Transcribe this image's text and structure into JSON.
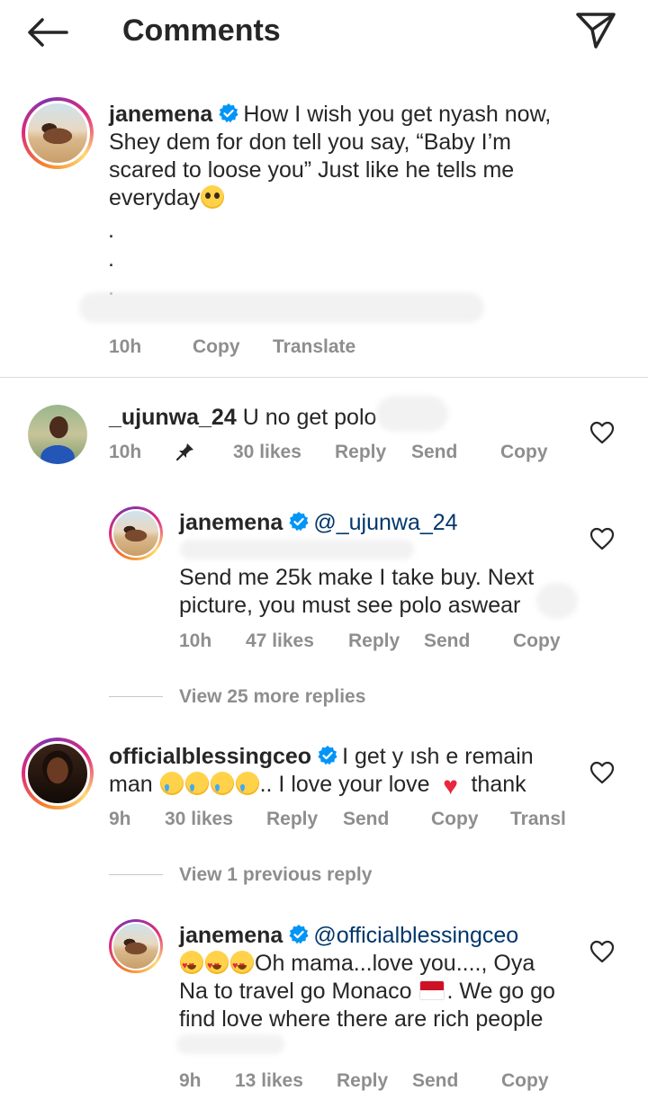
{
  "header": {
    "title": "Comments"
  },
  "caption": {
    "username": "janemena",
    "text_line1": "How I wish you get nyash now,",
    "text_line2": "Shey dem for don tell you say, “Baby I’m",
    "text_line3": "scared to loose you” Just like he tells me",
    "text_line4": "everyday",
    "dot": ".",
    "time": "10h",
    "copy": "Copy",
    "translate": "Translate"
  },
  "comments": [
    {
      "username": "_ujunwa_24",
      "text": "U no get polo",
      "time": "10h",
      "likes": "30 likes",
      "reply": "Reply",
      "send": "Send",
      "copy": "Copy"
    },
    {
      "username": "janemena",
      "mention": "@_ujunwa_24",
      "text_line1": "Send me 25k make I take buy. Next",
      "text_line2": "picture, you must see polo aswear",
      "time": "10h",
      "likes": "47 likes",
      "reply": "Reply",
      "send": "Send",
      "copy": "Copy"
    },
    {
      "view_more": "View 25 more replies"
    },
    {
      "username": "officialblessingceo",
      "text_line1": "I get y   ısh e remain",
      "text_line2_a": "man",
      "text_line2_b": ".. I love your love",
      "text_line2_c": "thank",
      "time": "9h",
      "likes": "30 likes",
      "reply": "Reply",
      "send": "Send",
      "copy": "Copy",
      "translate": "Transl"
    },
    {
      "view_more": "View 1 previous reply"
    },
    {
      "username": "janemena",
      "mention": "@officialblessingceo",
      "text_line1": "Oh mama...love you...., Oya",
      "text_line2_a": "Na to travel go Monaco",
      "text_line2_b": ". We go go",
      "text_line3": "find love where there are rich people",
      "time": "9h",
      "likes": "13 likes",
      "reply": "Reply",
      "send": "Send",
      "copy": "Copy"
    }
  ],
  "icons": {
    "back": "arrow-left-icon",
    "send": "paper-plane-icon",
    "verified": "verified-badge-icon",
    "like": "heart-outline-icon",
    "pin": "pin-icon"
  },
  "colors": {
    "text": "#262626",
    "meta": "#8e8e8e",
    "verified": "#0095f6",
    "mention": "#00376b"
  }
}
